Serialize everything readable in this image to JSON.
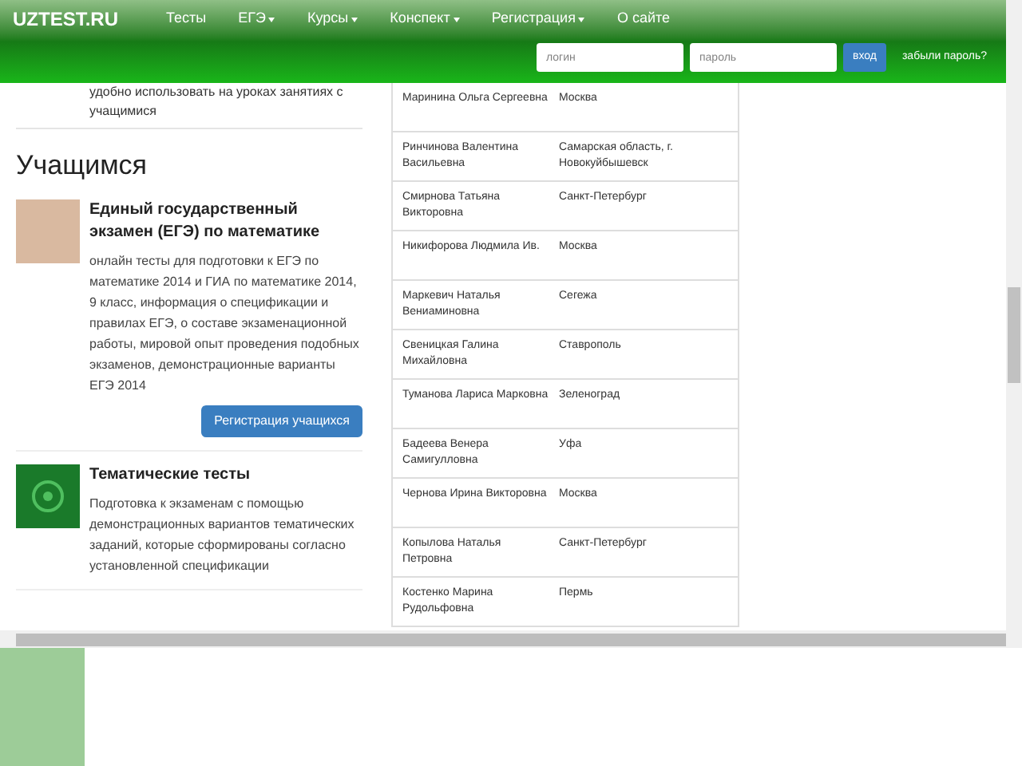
{
  "navbar": {
    "brand": "UZTEST.RU",
    "items": [
      {
        "label": "Тесты",
        "dropdown": false
      },
      {
        "label": "ЕГЭ",
        "dropdown": true
      },
      {
        "label": "Курсы",
        "dropdown": true
      },
      {
        "label": "Конспект",
        "dropdown": true
      },
      {
        "label": "Регистрация",
        "dropdown": true
      },
      {
        "label": "О сайте",
        "dropdown": false
      }
    ],
    "login": {
      "placeholder": "логин"
    },
    "password": {
      "placeholder": "пароль"
    },
    "submit": "вход",
    "forgot": "забыли пароль?"
  },
  "intro_tail": "удобно использовать на уроках занятиях с учащимися",
  "section_title": "Учащимся",
  "cards": [
    {
      "title": "Единый государственный экзамен (ЕГЭ) по математике",
      "text": "онлайн тесты для подготовки к ЕГЭ по математике 2014 и ГИА по математике 2014, 9 класс, информация о спецификации и правилах ЕГЭ, о составе экзаменационной работы, мировой опыт проведения подобных экзаменов, демонстрационные варианты ЕГЭ 2014",
      "button": "Регистрация учащихся",
      "kind": "photo"
    },
    {
      "title": "Тематические тесты",
      "text": "Подготовка к экзаменам с помощью демонстрационных вариантов тематических заданий, которые сформированы согласно установленной спецификации",
      "kind": "pattern"
    }
  ],
  "table": {
    "rows": [
      {
        "name": "Маринина Ольга Сергеевна",
        "city": "Москва"
      },
      {
        "name": "Ринчинова Валентина Васильевна",
        "city": "Самарская область, г. Новокуйбышевск"
      },
      {
        "name": "Смирнова Татьяна Викторовна",
        "city": "Санкт-Петербург"
      },
      {
        "name": "Никифорова Людмила Ив.",
        "city": "Москва"
      },
      {
        "name": "Маркевич Наталья Вениаминовна",
        "city": "Сегежа"
      },
      {
        "name": "Свеницкая Галина Михайловна",
        "city": "Ставрополь"
      },
      {
        "name": "Туманова Лариса Марковна",
        "city": "Зеленоград"
      },
      {
        "name": "Бадеева Венера Самигулловна",
        "city": "Уфа"
      },
      {
        "name": "Чернова Ирина Викторовна",
        "city": "Москва"
      },
      {
        "name": "Копылова Наталья Петровна",
        "city": "Санкт-Петербург"
      },
      {
        "name": "Костенко Марина Рудольфовна",
        "city": "Пермь"
      }
    ]
  }
}
